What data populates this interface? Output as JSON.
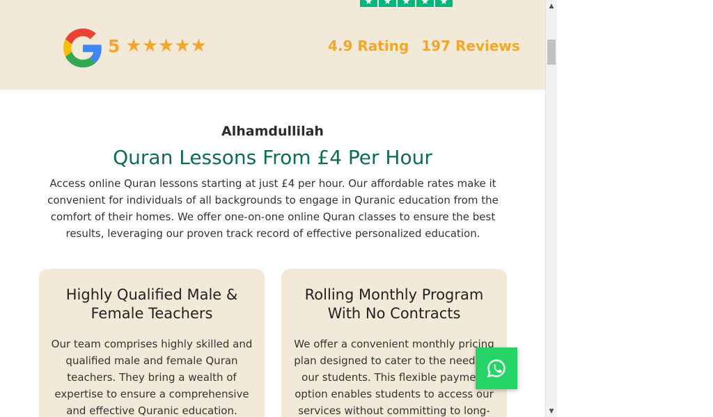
{
  "ratings": {
    "trustpilot_stars": "★★★★★",
    "google_score": "5",
    "google_stars": "★★★★★",
    "rating": "4.9 Rating",
    "reviews": "197 Reviews"
  },
  "colors": {
    "band_bg": "#f3e9d8",
    "accent_gold": "#f2a72c",
    "heading_green": "#0f6b55",
    "trustpilot_green": "#00b67a",
    "whatsapp_green": "#25d366"
  },
  "intro": {
    "kicker": "Alhamdullilah",
    "headline": "Quran Lessons From £4 Per Hour",
    "body": "Access online Quran lessons starting at just £4 per hour. Our affordable rates make it convenient for individuals of all backgrounds to engage in Quranic education from the comfort of their homes. We offer one-on-one online Quran classes to ensure the best results, leveraging our proven track record of effective personalized education."
  },
  "cards": [
    {
      "title": "Highly Qualified Male & Female Teachers",
      "body": "Our team comprises highly skilled and qualified male and female Quran teachers. They bring a wealth of expertise to ensure a comprehensive and effective Quranic education. These"
    },
    {
      "title": "Rolling Monthly Program With No Contracts",
      "body": "We offer a convenient monthly pricing plan designed to cater to the needs of our students. This flexible payment option enables students to access our services without committing to long-"
    }
  ],
  "icons": {
    "google": "google-logo-icon",
    "whatsapp": "whatsapp-icon",
    "scroll_up": "▲",
    "scroll_down": "▼"
  }
}
